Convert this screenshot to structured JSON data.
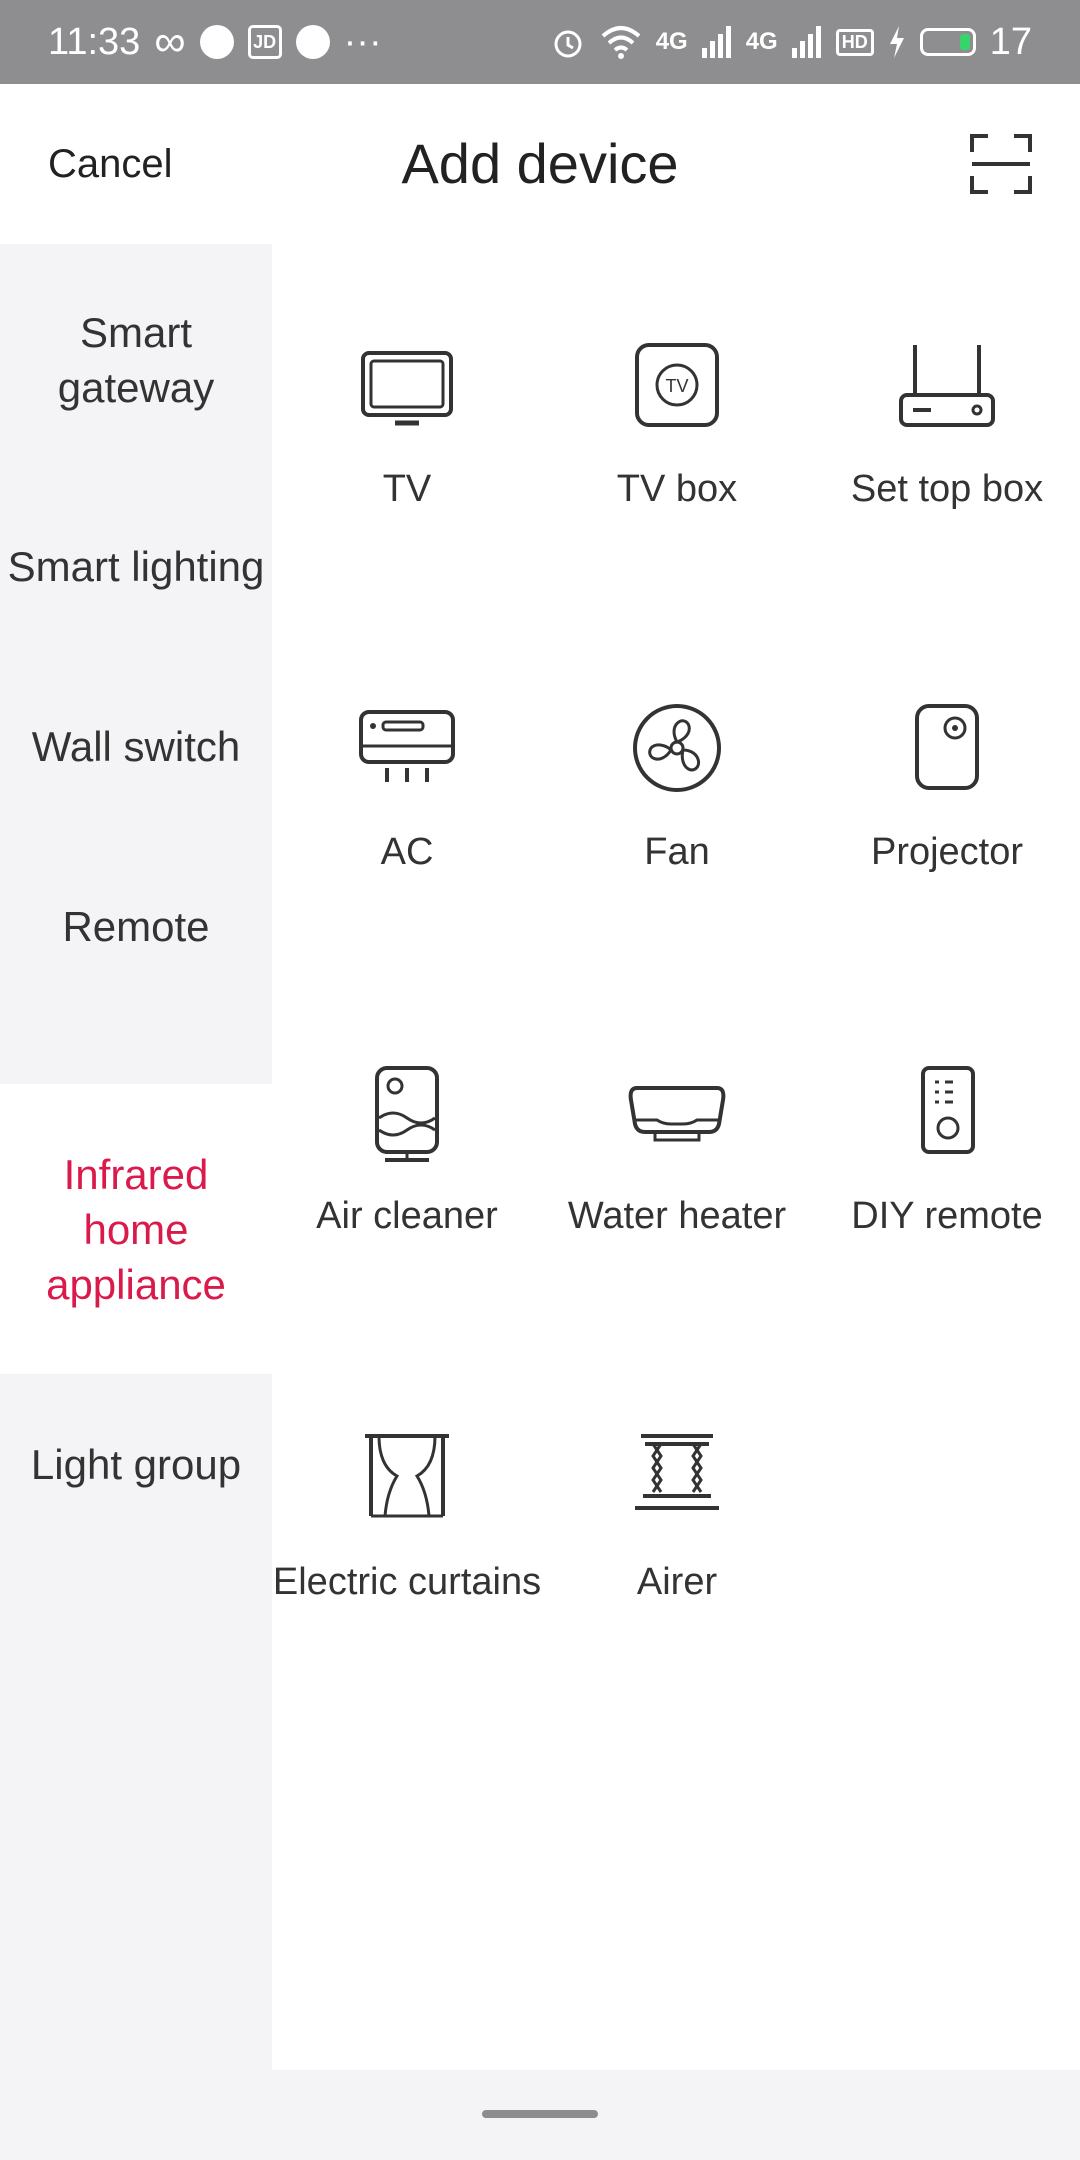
{
  "status_bar": {
    "time": "11:33",
    "infinity": "∞",
    "jd": "JD",
    "more": "···",
    "signal_1": "4G",
    "signal_2": "4G",
    "hd": "HD",
    "battery_level": "17"
  },
  "header": {
    "cancel_label": "Cancel",
    "title": "Add device"
  },
  "sidebar": {
    "items": [
      {
        "label": "Smart gateway"
      },
      {
        "label": "Smart lighting"
      },
      {
        "label": "Wall switch"
      },
      {
        "label": "Remote"
      },
      {
        "label": "Infrared home appliance"
      },
      {
        "label": "Light group"
      }
    ],
    "active_index": 4
  },
  "devices": [
    {
      "label": "TV",
      "icon": "tv-icon"
    },
    {
      "label": "TV box",
      "icon": "tv-box-icon"
    },
    {
      "label": "Set top box",
      "icon": "set-top-box-icon"
    },
    {
      "label": "AC",
      "icon": "air-conditioner-icon"
    },
    {
      "label": "Fan",
      "icon": "fan-icon"
    },
    {
      "label": "Projector",
      "icon": "projector-icon"
    },
    {
      "label": "Air cleaner",
      "icon": "air-cleaner-icon"
    },
    {
      "label": "Water heater",
      "icon": "water-heater-icon"
    },
    {
      "label": "DIY remote",
      "icon": "diy-remote-icon"
    },
    {
      "label": "Electric curtains",
      "icon": "curtains-icon"
    },
    {
      "label": "Airer",
      "icon": "airer-icon"
    }
  ],
  "colors": {
    "accent": "#d91a4a",
    "status_bar": "#8e8e90",
    "sidebar_bg": "#f4f3f5"
  }
}
